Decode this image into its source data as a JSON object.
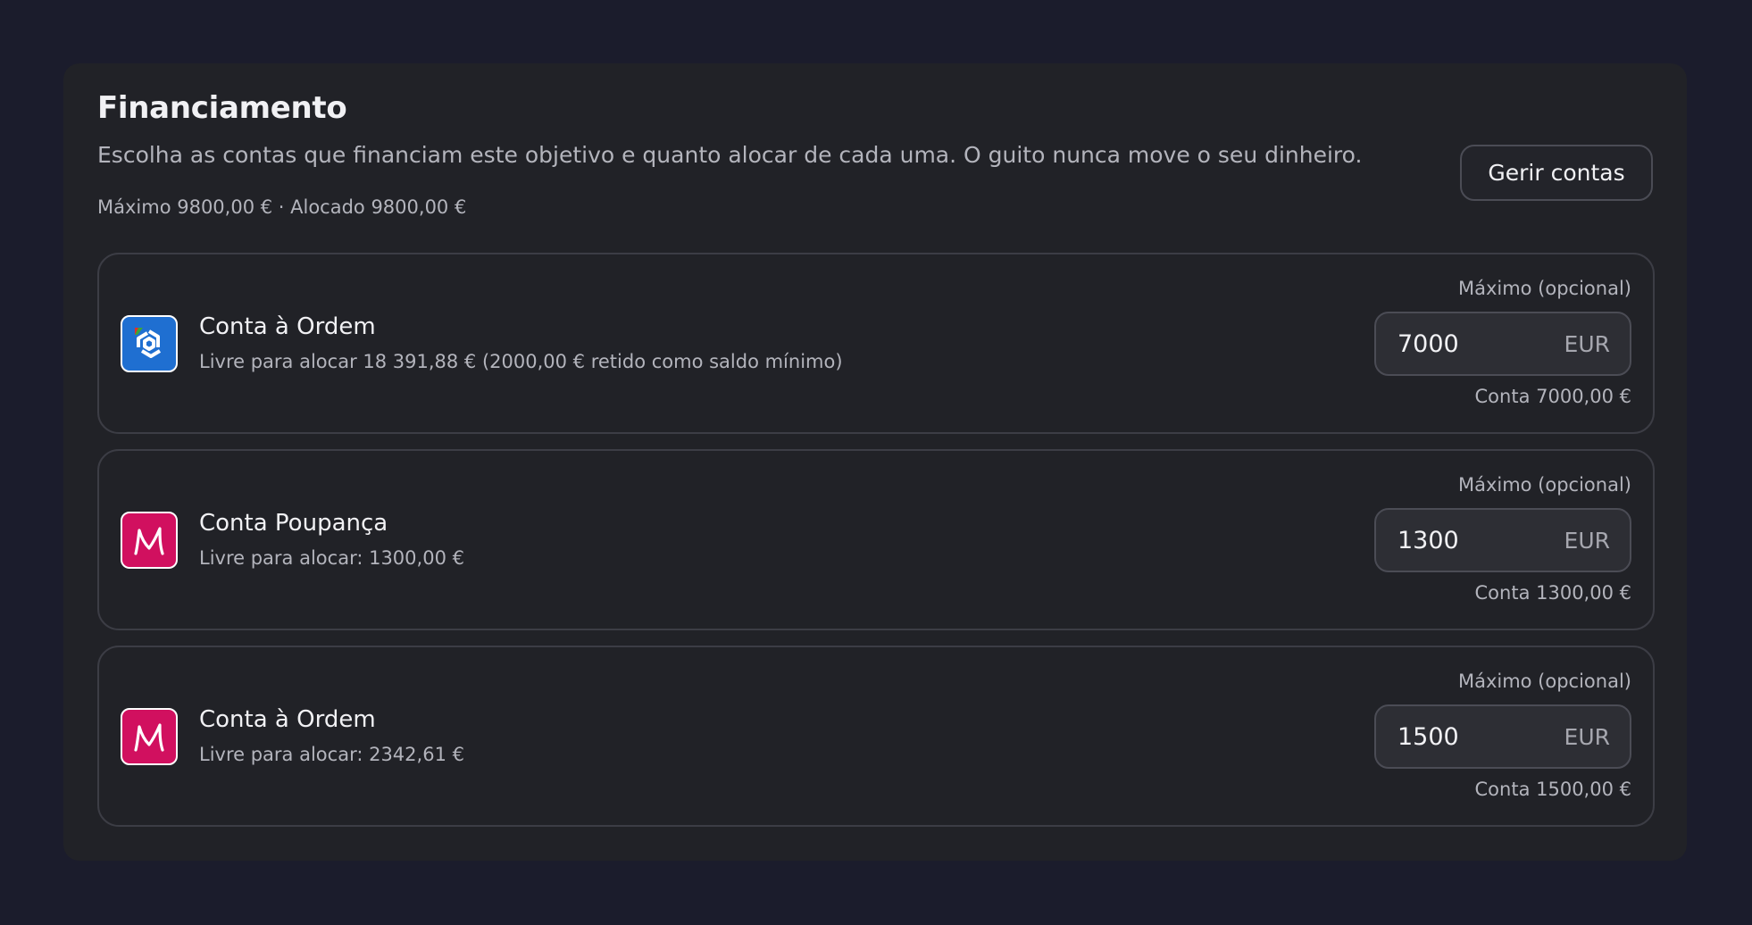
{
  "funding": {
    "title": "Financiamento",
    "description": "Escolha as contas que financiam este objetivo e quanto alocar de cada uma. O guito nunca move o seu dinheiro.",
    "summary": "Máximo 9800,00 € · Alocado 9800,00 €",
    "manage_button_label": "Gerir contas"
  },
  "accounts": [
    {
      "name": "Conta à Ordem",
      "free_text": "Livre para alocar 18 391,88 € (2000,00 € retido como saldo mínimo)",
      "max_label": "Máximo (opcional)",
      "amount_value": "7000",
      "currency": "EUR",
      "total_text": "Conta 7000,00 €",
      "logo_icon": "cgd-bank-logo",
      "logo_color": "#1f6fd1"
    },
    {
      "name": "Conta Poupança",
      "free_text": "Livre para alocar: 1300,00 €",
      "max_label": "Máximo (opcional)",
      "amount_value": "1300",
      "currency": "EUR",
      "total_text": "Conta 1300,00 €",
      "logo_icon": "millennium-bank-logo",
      "logo_color": "#d1105f"
    },
    {
      "name": "Conta à Ordem",
      "free_text": "Livre para alocar: 2342,61 €",
      "max_label": "Máximo (opcional)",
      "amount_value": "1500",
      "currency": "EUR",
      "total_text": "Conta 1500,00 €",
      "logo_icon": "millennium-bank-logo",
      "logo_color": "#d1105f"
    }
  ]
}
